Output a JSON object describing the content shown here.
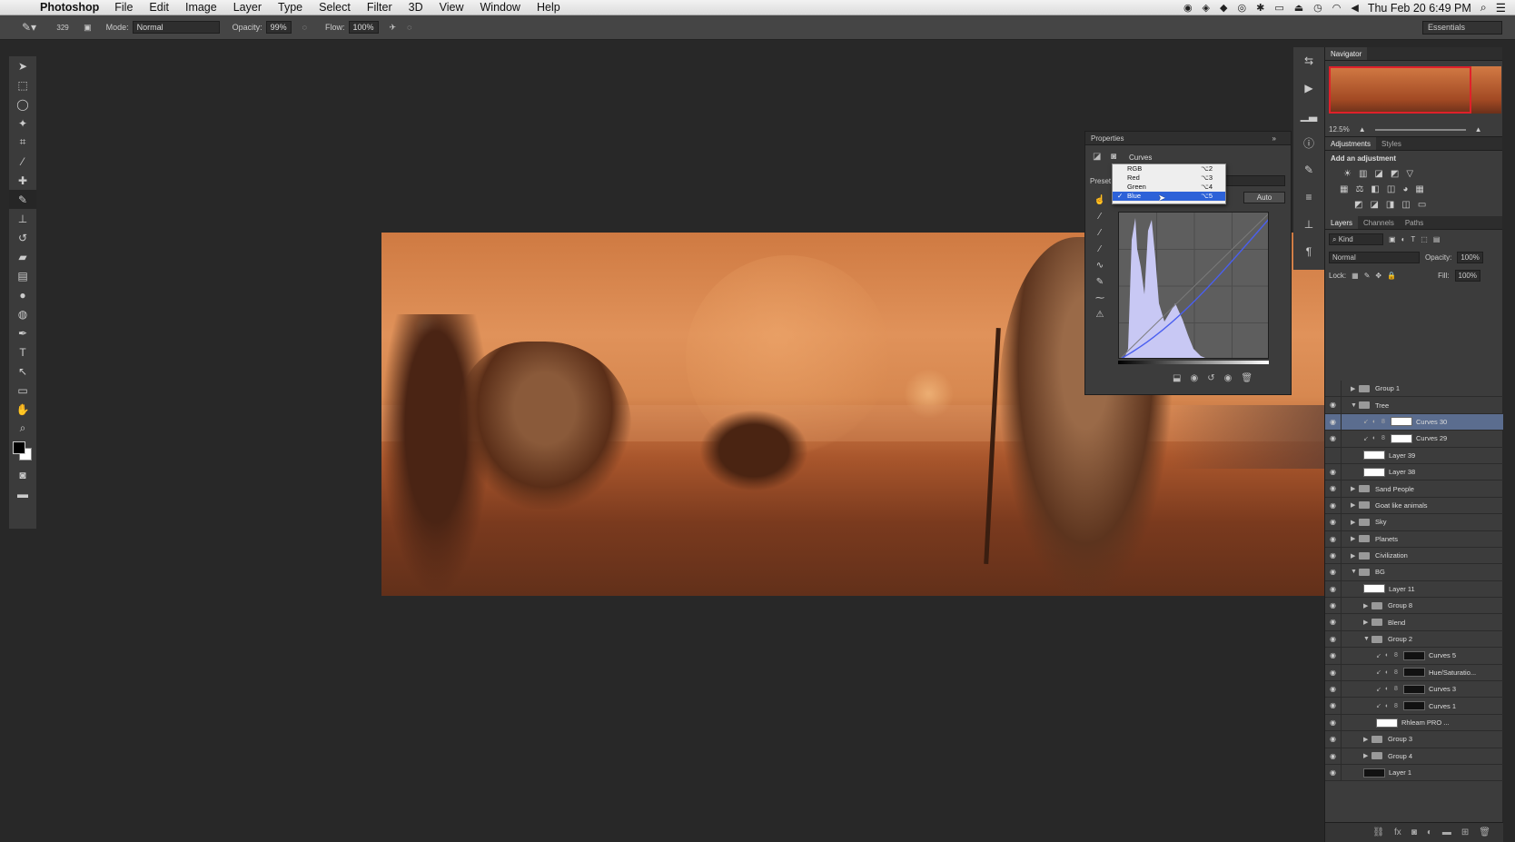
{
  "menubar": {
    "app_name": "Photoshop",
    "menus": [
      "File",
      "Edit",
      "Image",
      "Layer",
      "Type",
      "Select",
      "Filter",
      "3D",
      "View",
      "Window",
      "Help"
    ],
    "clock": "Thu Feb 20  6:49 PM"
  },
  "options": {
    "brush_size": "329",
    "mode_label": "Mode:",
    "mode_value": "Normal",
    "opacity_label": "Opacity:",
    "opacity_value": "99%",
    "flow_label": "Flow:",
    "flow_value": "100%",
    "workspace": "Essentials"
  },
  "properties": {
    "tab": "Properties",
    "title": "Curves",
    "preset_label": "Preset",
    "auto_label": "Auto",
    "channel_menu": [
      {
        "label": "RGB",
        "shortcut": "⌥2",
        "selected": false
      },
      {
        "label": "Red",
        "shortcut": "⌥3",
        "selected": false
      },
      {
        "label": "Green",
        "shortcut": "⌥4",
        "selected": false
      },
      {
        "label": "Blue",
        "shortcut": "⌥5",
        "selected": true
      }
    ],
    "check": "✓"
  },
  "navigator": {
    "tab": "Navigator",
    "zoom": "12.5%"
  },
  "adjustments": {
    "tabs": [
      "Adjustments",
      "Styles"
    ],
    "add_label": "Add an adjustment"
  },
  "layers": {
    "tabs": [
      "Layers",
      "Channels",
      "Paths"
    ],
    "kind": "Kind",
    "blend_mode": "Normal",
    "opacity_label": "Opacity:",
    "opacity": "100%",
    "lock_label": "Lock:",
    "fill_label": "Fill:",
    "fill": "100%",
    "items": [
      {
        "name": "Group 1",
        "type": "group",
        "indent": 0,
        "expanded": false,
        "visible": false
      },
      {
        "name": "Tree",
        "type": "group",
        "indent": 0,
        "expanded": true,
        "visible": true
      },
      {
        "name": "Curves 30",
        "type": "adjustment",
        "indent": 1,
        "visible": true,
        "selected": true
      },
      {
        "name": "Curves 29",
        "type": "adjustment",
        "indent": 1,
        "visible": true
      },
      {
        "name": "Layer 39",
        "type": "layer",
        "indent": 1,
        "visible": false
      },
      {
        "name": "Layer 38",
        "type": "layer",
        "indent": 1,
        "visible": true
      },
      {
        "name": "Sand People",
        "type": "group",
        "indent": 0,
        "expanded": false,
        "visible": true
      },
      {
        "name": "Goat like animals",
        "type": "group",
        "indent": 0,
        "expanded": false,
        "visible": true
      },
      {
        "name": "Sky",
        "type": "group",
        "indent": 0,
        "expanded": false,
        "visible": true
      },
      {
        "name": "Planets",
        "type": "group",
        "indent": 0,
        "expanded": false,
        "visible": true
      },
      {
        "name": "Civilization",
        "type": "group",
        "indent": 0,
        "expanded": false,
        "visible": true
      },
      {
        "name": "BG",
        "type": "group",
        "indent": 0,
        "expanded": true,
        "visible": true
      },
      {
        "name": "Layer 11",
        "type": "layer",
        "indent": 1,
        "visible": true
      },
      {
        "name": "Group 8",
        "type": "group",
        "indent": 1,
        "expanded": false,
        "visible": true
      },
      {
        "name": "Blend",
        "type": "group",
        "indent": 1,
        "expanded": false,
        "visible": true
      },
      {
        "name": "Group 2",
        "type": "group",
        "indent": 1,
        "expanded": true,
        "visible": true
      },
      {
        "name": "Curves 5",
        "type": "adjustment",
        "indent": 2,
        "visible": true
      },
      {
        "name": "Hue/Saturatio...",
        "type": "adjustment",
        "indent": 2,
        "visible": true
      },
      {
        "name": "Curves 3",
        "type": "adjustment",
        "indent": 2,
        "visible": true
      },
      {
        "name": "Curves 1",
        "type": "adjustment",
        "indent": 2,
        "visible": true
      },
      {
        "name": "Rhleam PRO ...",
        "type": "layer",
        "indent": 2,
        "visible": true
      },
      {
        "name": "Group 3",
        "type": "group",
        "indent": 1,
        "expanded": false,
        "visible": true
      },
      {
        "name": "Group 4",
        "type": "group",
        "indent": 1,
        "expanded": false,
        "visible": true
      },
      {
        "name": "Layer 1",
        "type": "layer",
        "indent": 1,
        "visible": true
      }
    ]
  },
  "colors": {
    "selection_blue": "#2d62d8",
    "layer_selected": "#5b6d8f",
    "navigator_view": "#e0202a"
  }
}
